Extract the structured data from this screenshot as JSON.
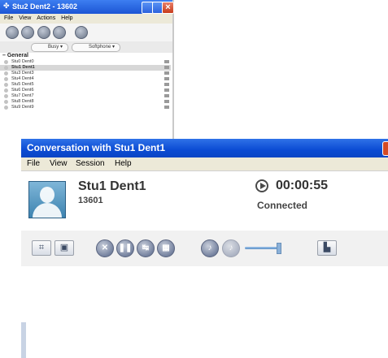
{
  "bg_window": {
    "title": "Stu2 Dent2 - 13602",
    "menu": [
      "File",
      "View",
      "Actions",
      "Help"
    ],
    "status_combo": "Busy",
    "device_combo": "Softphone",
    "group": "General",
    "contacts": [
      "Stu0 Dent0",
      "Stu1 Dent1",
      "Stu3 Dent3",
      "Stu4 Dent4",
      "Stu5 Dent5",
      "Stu6 Dent6",
      "Stu7 Dent7",
      "Stu8 Dent8",
      "Stu9 Dent9"
    ],
    "selected_contact": "Stu1 Dent1"
  },
  "conversation": {
    "title": "Conversation with Stu1 Dent1",
    "menu": {
      "file": "File",
      "view": "View",
      "session": "Session",
      "help": "Help"
    },
    "contact_name": "Stu1 Dent1",
    "contact_number": "13601",
    "timer": "00:00:55",
    "status": "Connected",
    "volume_level": 0.9
  },
  "colors": {
    "title_bar": "#0b4bd3",
    "accent": "#2f72e8",
    "close": "#d44a24"
  }
}
